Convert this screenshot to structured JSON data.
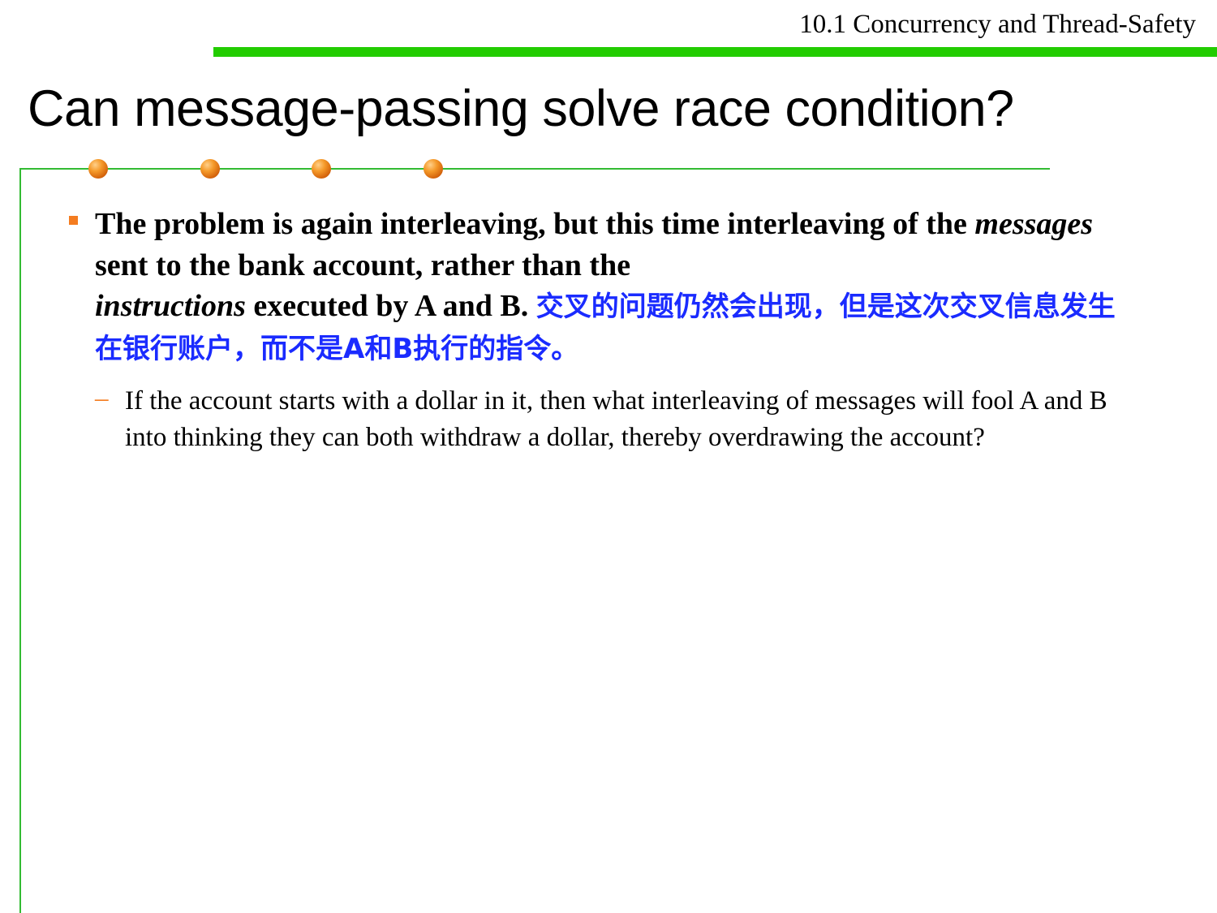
{
  "header": {
    "section_title": "10.1 Concurrency and Thread-Safety",
    "bar_color": "#22cc00"
  },
  "slide": {
    "title": "Can message-passing solve race condition?"
  },
  "bullet": {
    "part1": "The problem is again interleaving, but this time interleaving of the ",
    "em1": "messages",
    "part2": " sent to the bank account, rather than the ",
    "em2": "instructions",
    "part3": " executed by A and B. ",
    "chinese": "交叉的问题仍然会出现，但是这次交叉信息发生在银行账户，而不是A和B执行的指令。",
    "chinese_color": "#1a2bff"
  },
  "sub_bullet": {
    "dash": "–",
    "text": "If the account starts with a dollar in it, then what interleaving of messages will fool A and B into thinking they can both withdraw a dollar, thereby overdrawing the account?"
  },
  "colors": {
    "accent_orange": "#f47c20",
    "rule_green": "#33bb33"
  }
}
